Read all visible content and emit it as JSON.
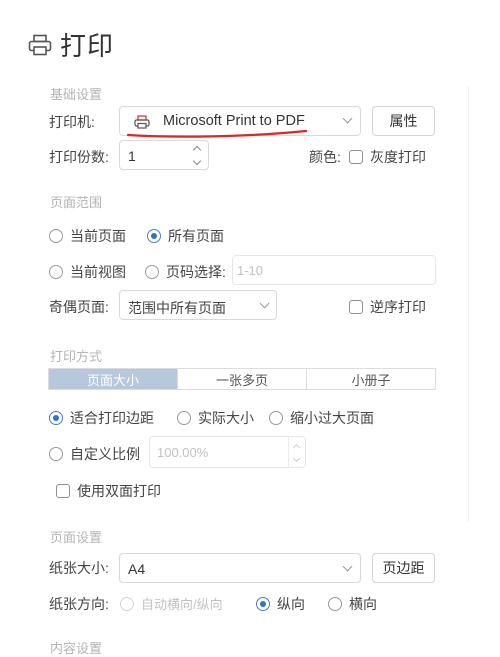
{
  "title": "打印",
  "basic": {
    "section": "基础设置",
    "printer_label": "打印机:",
    "printer_value": "Microsoft Print to PDF",
    "properties_button": "属性",
    "copies_label": "打印份数:",
    "copies_value": "1",
    "color_label": "颜色:",
    "grayscale_label": "灰度打印"
  },
  "range": {
    "section": "页面范围",
    "current_page": "当前页面",
    "all_pages": "所有页面",
    "current_view": "当前视图",
    "page_select": "页码选择:",
    "page_select_placeholder": "1-10",
    "odd_even_label": "奇偶页面:",
    "odd_even_value": "范围中所有页面",
    "reverse_label": "逆序打印"
  },
  "mode": {
    "section": "打印方式",
    "tabs": [
      "页面大小",
      "一张多页",
      "小册子"
    ],
    "fit_margin": "适合打印边距",
    "actual_size": "实际大小",
    "shrink_large": "缩小过大页面",
    "custom_scale": "自定义比例",
    "custom_scale_value": "100.00%",
    "duplex_label": "使用双面打印"
  },
  "page": {
    "section": "页面设置",
    "paper_size_label": "纸张大小:",
    "paper_size_value": "A4",
    "margins_button": "页边距",
    "orientation_label": "纸张方向:",
    "auto_orientation": "自动横向/纵向",
    "portrait": "纵向",
    "landscape": "横向"
  },
  "content": {
    "section": "内容设置"
  },
  "colors": {
    "accent": "#2f6fd6",
    "annotation_red": "#e0262b",
    "tab_selected": "#b8c8dc"
  }
}
